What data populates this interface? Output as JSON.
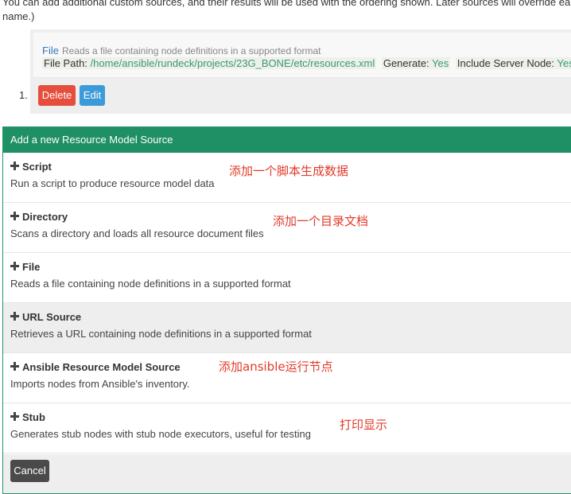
{
  "intro": {
    "line1": "You can add additional custom sources, and their results will be used with the ordering shown. Later sources will override earlier",
    "line2": "name.)"
  },
  "existing_source": {
    "index": "1.",
    "type": "File",
    "description": "Reads a file containing node definitions in a supported format",
    "file_path_label": "File Path:",
    "file_path_value": "/home/ansible/rundeck/projects/23G_BONE/etc/resources.xml",
    "generate_label": "Generate:",
    "generate_value": "Yes",
    "include_label": "Include Server Node:",
    "include_value": "Yes",
    "delete_label": "Delete",
    "edit_label": "Edit"
  },
  "panel": {
    "heading": "Add a new Resource Model Source",
    "items": [
      {
        "title": "Script",
        "description": "Run a script to produce resource model data",
        "annotation": "添加一个脚本生成数据"
      },
      {
        "title": "Directory",
        "description": "Scans a directory and loads all resource document files",
        "annotation": "添加一个目录文档"
      },
      {
        "title": "File",
        "description": "Reads a file containing node definitions in a supported format",
        "annotation": ""
      },
      {
        "title": "URL Source",
        "description": "Retrieves a URL containing node definitions in a supported format",
        "annotation": ""
      },
      {
        "title": "Ansible Resource Model Source",
        "description": "Imports nodes from Ansible's inventory.",
        "annotation": "添加ansible运行节点"
      },
      {
        "title": "Stub",
        "description": "Generates stub nodes with stub node executors, useful for testing",
        "annotation": "打印显示"
      }
    ],
    "cancel_label": "Cancel"
  },
  "colors": {
    "panel_heading": "#1f8f66",
    "delete_button": "#e54d3c",
    "edit_button": "#3b9ad8",
    "annotation_text": "#e23a2a",
    "value_text": "#3a9a6e",
    "link_text": "#337ab7"
  }
}
